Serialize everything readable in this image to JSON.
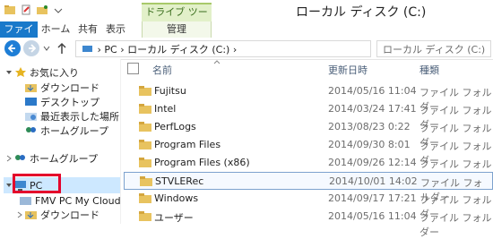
{
  "window": {
    "title": "ローカル ディスク (C:)",
    "context_tab_group": "ドライブ ツール"
  },
  "ribbon": {
    "tabs": [
      {
        "label": "ファイル"
      },
      {
        "label": "ホーム"
      },
      {
        "label": "共有"
      },
      {
        "label": "表示"
      },
      {
        "label": "管理"
      }
    ]
  },
  "address": {
    "crumbs": [
      "PC",
      "ローカル ディスク (C:)"
    ],
    "search_placeholder": "ローカル ディスク (C:)"
  },
  "nav": {
    "items": [
      {
        "label": "お気に入り"
      },
      {
        "label": "ダウンロード"
      },
      {
        "label": "デスクトップ"
      },
      {
        "label": "最近表示した場所"
      },
      {
        "label": "ホームグループ"
      },
      {
        "label": "ホームグループ"
      },
      {
        "label": "PC"
      },
      {
        "label": "FMV PC My Cloudモ"
      },
      {
        "label": "ダウンロード"
      }
    ]
  },
  "list": {
    "headers": {
      "name": "名前",
      "date": "更新日時",
      "type": "種類"
    },
    "rows": [
      {
        "name": "Fujitsu",
        "date": "2014/05/16 11:04",
        "type": "ファイル フォルダー"
      },
      {
        "name": "Intel",
        "date": "2014/03/24 17:41",
        "type": "ファイル フォルダー"
      },
      {
        "name": "PerfLogs",
        "date": "2013/08/23 0:22",
        "type": "ファイル フォルダー"
      },
      {
        "name": "Program Files",
        "date": "2014/09/30 8:01",
        "type": "ファイル フォルダー"
      },
      {
        "name": "Program Files (x86)",
        "date": "2014/09/26 12:14",
        "type": "ファイル フォルダー"
      },
      {
        "name": "STVLERec",
        "date": "2014/10/01 14:02",
        "type": "ファイル フォルダー"
      },
      {
        "name": "Windows",
        "date": "2014/09/17 17:21",
        "type": "ファイル フォルダー"
      },
      {
        "name": "ユーザー",
        "date": "2014/05/16 11:04",
        "type": "ファイル フォルダー"
      }
    ]
  },
  "colors": {
    "accent": "#1979ca",
    "context": "#e2f0c9",
    "selection": "#cde8ff",
    "highlight": "#e4002b",
    "folder": "#e8c35f"
  }
}
